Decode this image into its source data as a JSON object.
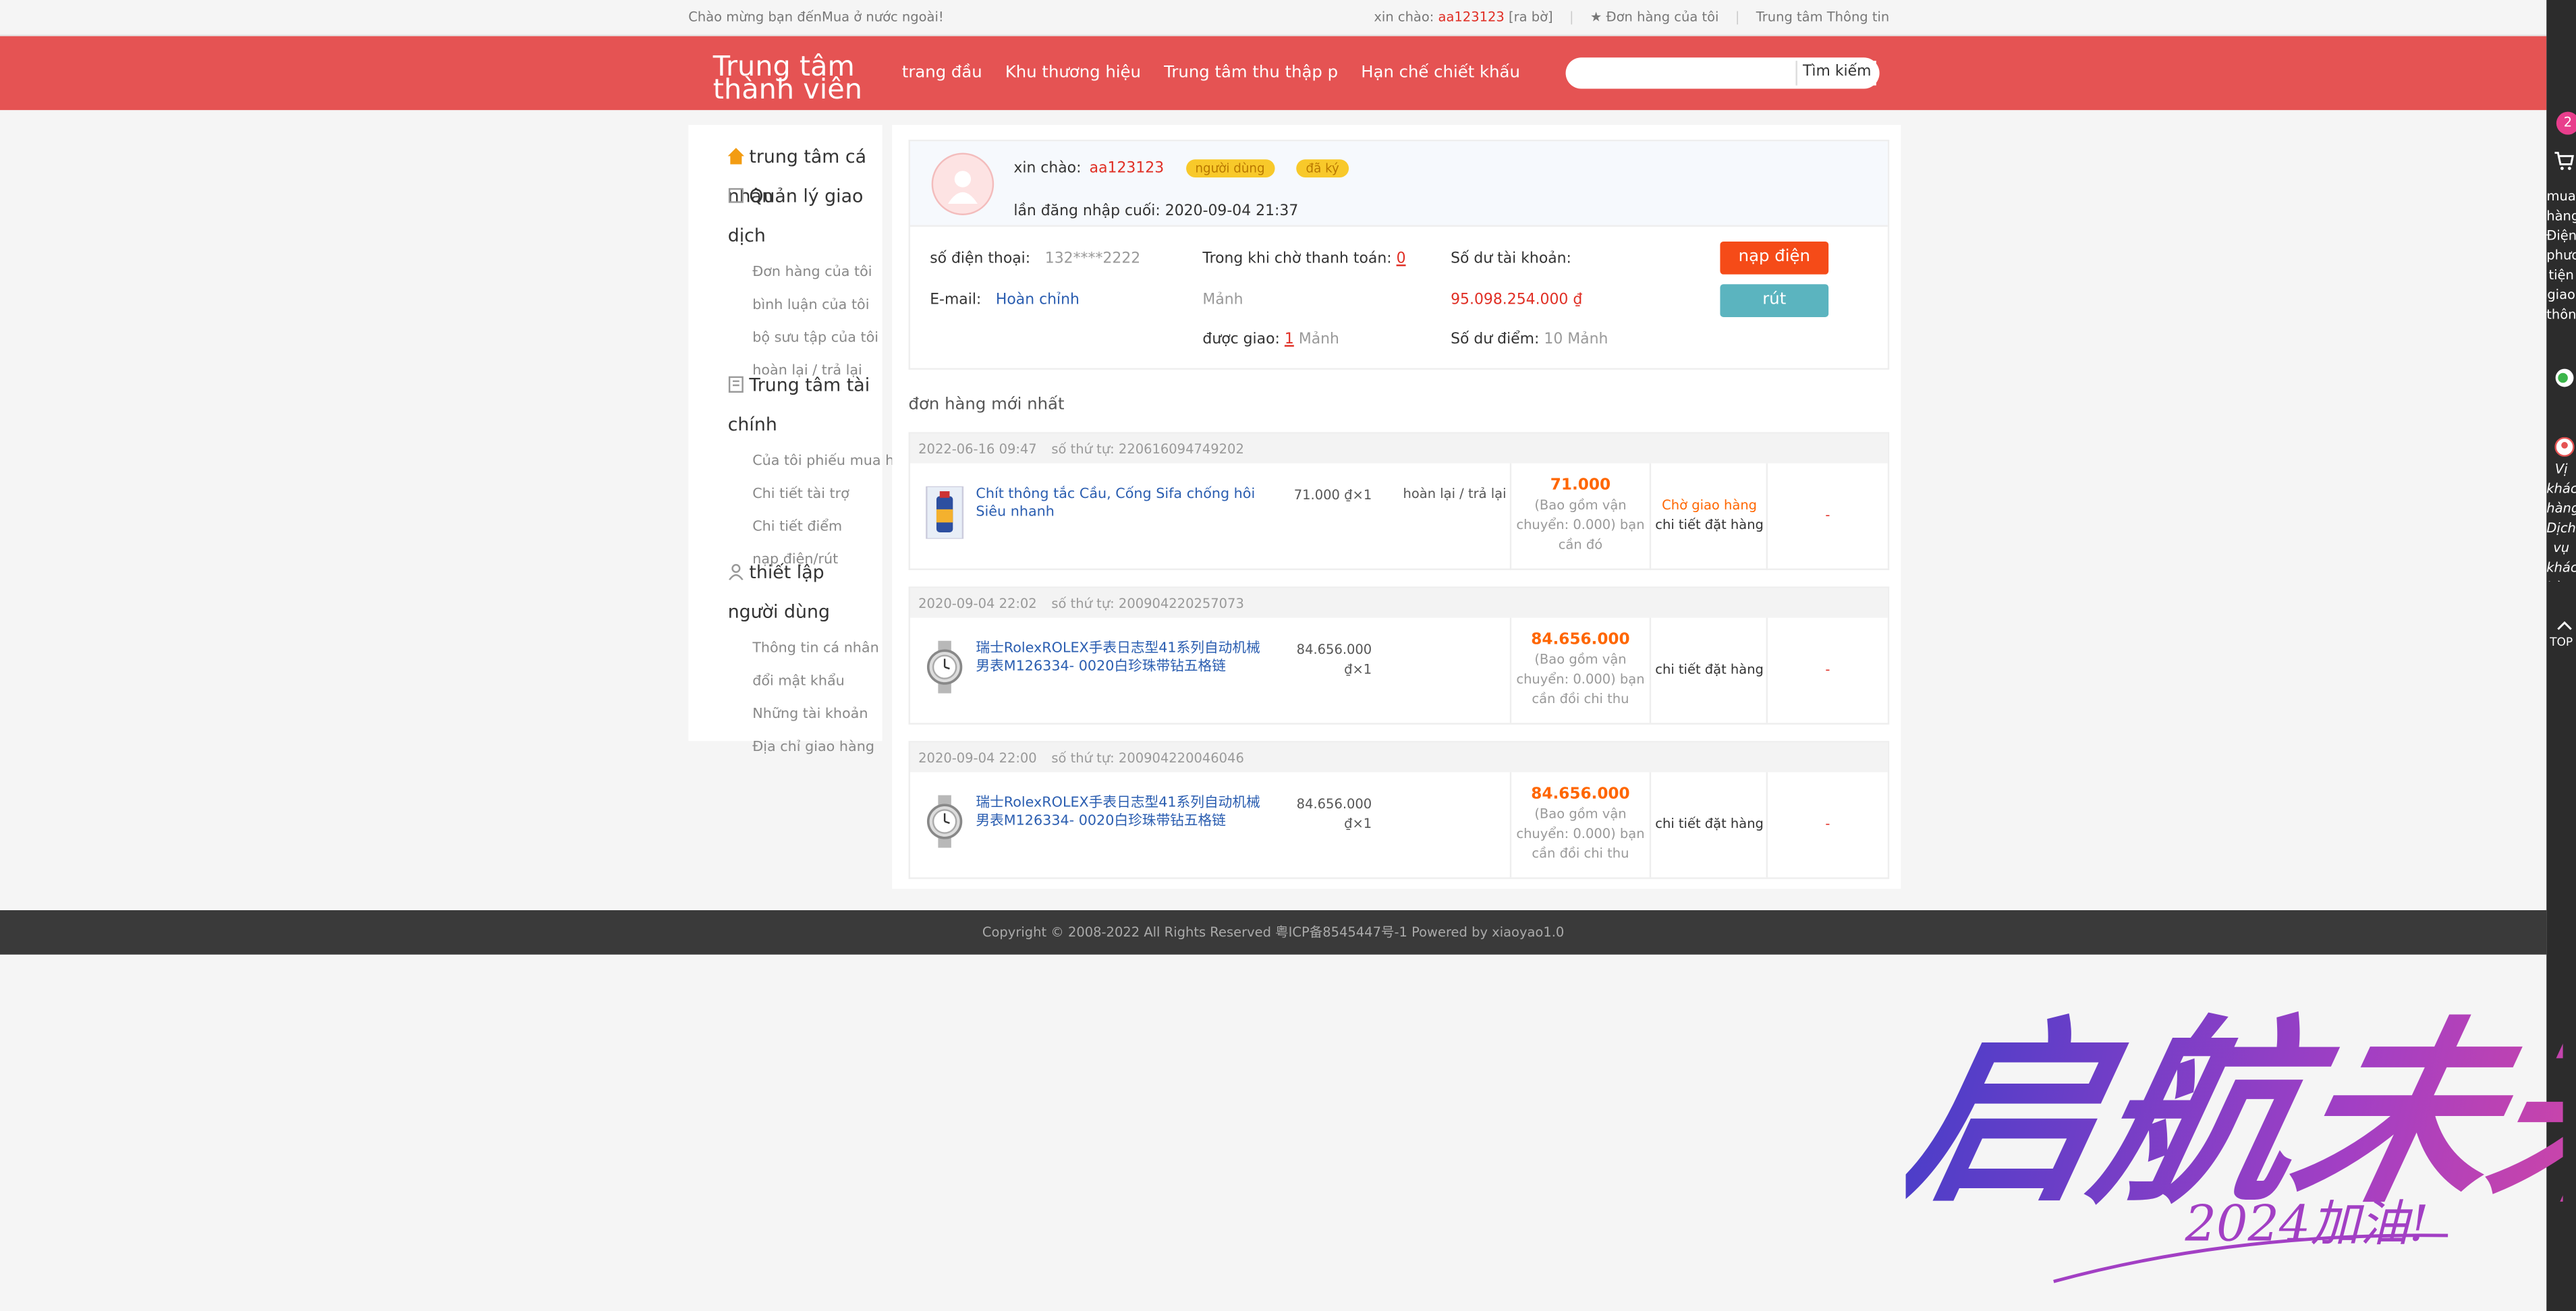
{
  "topbar": {
    "welcome": "Chào mừng bạn đếnMua ở nước ngoài!",
    "hello_label": "xin chào:",
    "username": "aa123123",
    "logout": "[ra bờ]",
    "my_orders": "★ Đơn hàng của tôi",
    "info_center": "Trung tâm Thông tin"
  },
  "header": {
    "logo": "Trung tâm thành viên",
    "nav": [
      "trang đầu",
      "Khu thương hiệu",
      "Trung tâm thu thập p",
      "Hạn chế chiết khấu"
    ],
    "search_placeholder": "",
    "search_button": "Tìm kiếm"
  },
  "sidebar": {
    "groups": [
      {
        "title": "trung tâm cá nhân",
        "items": []
      },
      {
        "title": "Quản lý giao dịch",
        "items": [
          "Đơn hàng của tôi",
          "bình luận của tôi",
          "bộ sưu tập của tôi",
          "hoàn lại / trả lại"
        ]
      },
      {
        "title": "Trung tâm tài chính",
        "items": [
          "Của tôi phiếu mua hàng",
          "Chi tiết tài trợ",
          "Chi tiết điểm",
          "nạp điện/rút"
        ]
      },
      {
        "title": "thiết lập người dùng",
        "items": [
          "Thông tin cá nhân",
          "đổi mật khẩu",
          "Những tài khoản",
          "Địa chỉ giao hàng"
        ]
      }
    ]
  },
  "user": {
    "hello": "xin chào:",
    "username": "aa123123",
    "badge_user": "người dùng",
    "badge_registered": "đã ký",
    "last_login_label": "lần đăng nhập cuối:",
    "last_login": "2020-09-04 21:37",
    "phone_label": "số điện thoại:",
    "phone": "132****2222",
    "email_label": "E-mail:",
    "email": "Hoàn chỉnh",
    "pending_pay_label": "Trong khi chờ thanh toán:",
    "pending_pay": "0",
    "pending_unit": "Mảnh",
    "delivered_label": "được giao:",
    "delivered": "1",
    "delivered_unit": "Mảnh",
    "balance_label": "Số dư tài khoản:",
    "balance": "95.098.254.000 ₫",
    "points_label": "Số dư điểm:",
    "points": "10 Mảnh",
    "charge_button": "nạp điện",
    "withdraw_button": "rút"
  },
  "orders_title": "đơn hàng mới nhất",
  "orders": [
    {
      "date": "2022-06-16 09:47",
      "num_label": "số thứ tự:",
      "num": "220616094749202",
      "name": "Chít thông tắc Cầu, Cống Sifa chống hôi Siêu nhanh",
      "price": "71.000 ₫×1",
      "return": "hoàn lại / trả lại",
      "total": "71.000",
      "total_note": "(Bao gồm vận chuyển: 0.000) bạn cần đó",
      "status": "Chờ giao hàng",
      "detail": "chi tiết đặt hàng",
      "action": "-"
    },
    {
      "date": "2020-09-04 22:02",
      "num_label": "số thứ tự:",
      "num": "200904220257073",
      "name": "瑞士RolexROLEX手表日志型41系列自动机械男表M126334- 0020白珍珠带钻五格链",
      "price": "84.656.000 ₫×1",
      "return": "",
      "total": "84.656.000",
      "total_note": "(Bao gồm vận chuyển: 0.000) bạn cần đồi chi thu",
      "status": "",
      "detail": "chi tiết đặt hàng",
      "action": "-"
    },
    {
      "date": "2020-09-04 22:00",
      "num_label": "số thứ tự:",
      "num": "200904220046046",
      "name": "瑞士RolexROLEX手表日志型41系列自动机械男表M126334- 0020白珍珠带钻五格链",
      "price": "84.656.000 ₫×1",
      "return": "",
      "total": "84.656.000",
      "total_note": "(Bao gồm vận chuyển: 0.000) bạn cần đồi chi thu",
      "status": "",
      "detail": "chi tiết đặt hàng",
      "action": "-"
    }
  ],
  "footer": "Copyright © 2008-2022 All Rights Reserved 粤ICP备8545447号-1   Powered by xiaoyao1.0",
  "rightbar": {
    "cart_count": "2",
    "cart_text": "mua hàng Điện phương tiện giao thông",
    "service_text": "Vị khách hàng Dịch vụ khách hàng",
    "top_text": "TOP"
  },
  "watermark": {
    "main": "启航未来",
    "sub": "2024加油!"
  },
  "colors": {
    "brand_red": "#e55353",
    "accent_orange": "#f54b18",
    "teal": "#5bb4bf"
  }
}
